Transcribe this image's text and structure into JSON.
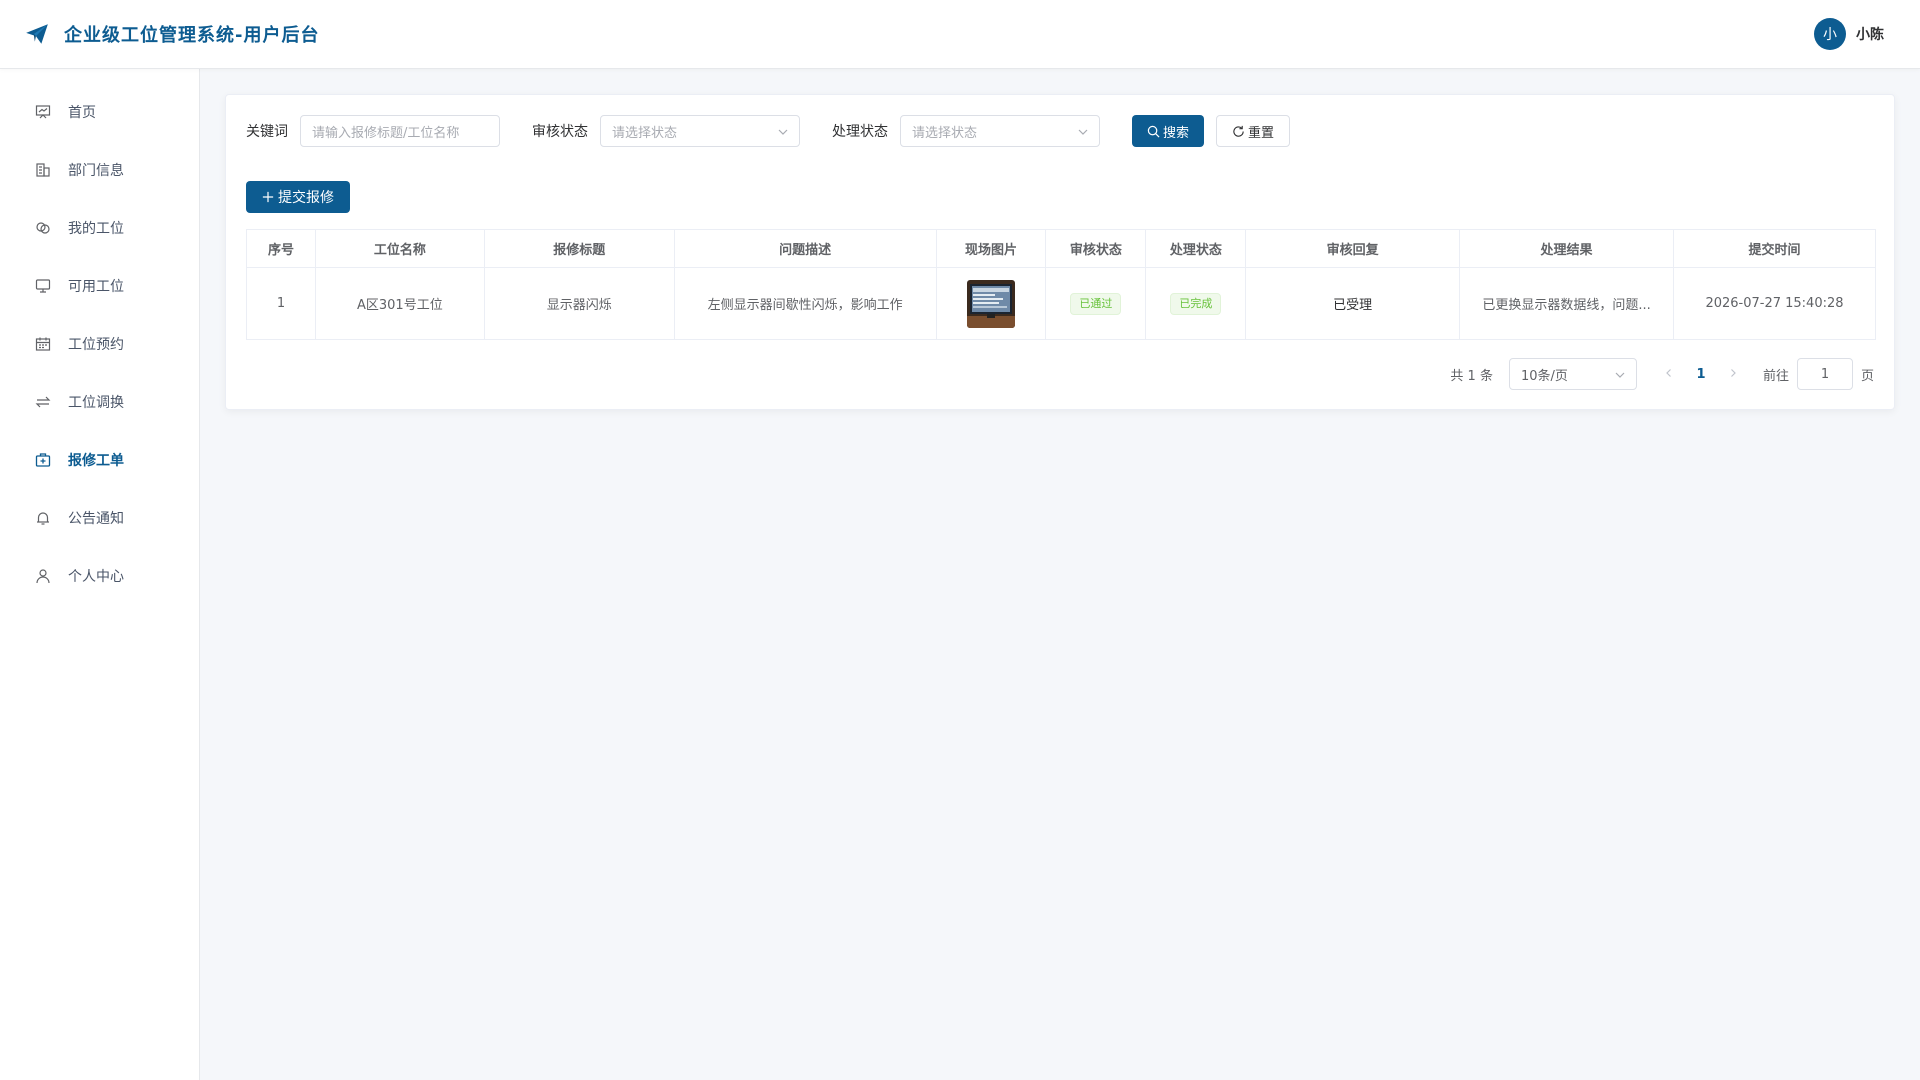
{
  "header": {
    "title": "企业级工位管理系统-用户后台",
    "avatar_text": "小",
    "user_name": "小陈"
  },
  "sidebar": {
    "items": [
      {
        "label": "首页",
        "icon": "presentation-icon"
      },
      {
        "label": "部门信息",
        "icon": "building-icon"
      },
      {
        "label": "我的工位",
        "icon": "link-icon"
      },
      {
        "label": "可用工位",
        "icon": "monitor-icon"
      },
      {
        "label": "工位预约",
        "icon": "calendar-icon"
      },
      {
        "label": "工位调换",
        "icon": "swap-icon"
      },
      {
        "label": "报修工单",
        "icon": "first-aid-kit-icon",
        "active": true
      },
      {
        "label": "公告通知",
        "icon": "bell-icon"
      },
      {
        "label": "个人中心",
        "icon": "user-icon"
      }
    ]
  },
  "filters": {
    "keyword_label": "关键词",
    "keyword_placeholder": "请输入报修标题/工位名称",
    "audit_label": "审核状态",
    "audit_placeholder": "请选择状态",
    "process_label": "处理状态",
    "process_placeholder": "请选择状态",
    "search_label": "搜索",
    "reset_label": "重置"
  },
  "add_button_label": "提交报修",
  "table": {
    "columns": [
      "序号",
      "工位名称",
      "报修标题",
      "问题描述",
      "现场图片",
      "审核状态",
      "处理状态",
      "审核回复",
      "处理结果",
      "提交时间"
    ],
    "rows": [
      {
        "index": "1",
        "station": "A区301号工位",
        "title": "显示器闪烁",
        "description": "左侧显示器间歇性闪烁，影响工作",
        "audit_status": "已通过",
        "process_status": "已完成",
        "reply": "已受理",
        "result": "已更换显示器数据线，问题...",
        "time": "2026-07-27 15:40:28"
      }
    ]
  },
  "pagination": {
    "total": "共 1 条",
    "page_size": "10条/页",
    "current": "1",
    "goto_label": "前往",
    "goto_value": "1",
    "page_suffix": "页"
  },
  "colors": {
    "primary": "#0d5c91",
    "success": "#67c23a"
  }
}
